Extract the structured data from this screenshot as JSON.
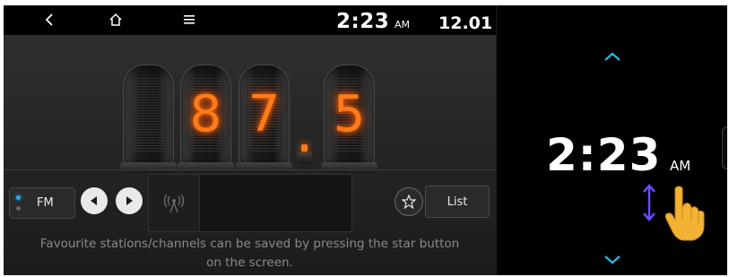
{
  "topbar": {
    "back_icon": "back-chevron-icon",
    "home_icon": "home-icon",
    "menu_icon": "menu-icon",
    "time": "2:23",
    "ampm": "AM",
    "date": "12.01"
  },
  "radio": {
    "digits": [
      "8",
      "7",
      "5"
    ],
    "band": "FM",
    "list_label": "List",
    "hint_line1": "Favourite stations/channels can be saved by pressing the star button",
    "hint_line2": "on the screen."
  },
  "clock_panel": {
    "time": "2:23",
    "ampm": "AM"
  },
  "colors": {
    "nixie_orange": "#ff7a1a",
    "accent_cyan": "#2ab3d6",
    "gesture_purple": "#6a4cff",
    "hand_yellow": "#f2b233"
  }
}
